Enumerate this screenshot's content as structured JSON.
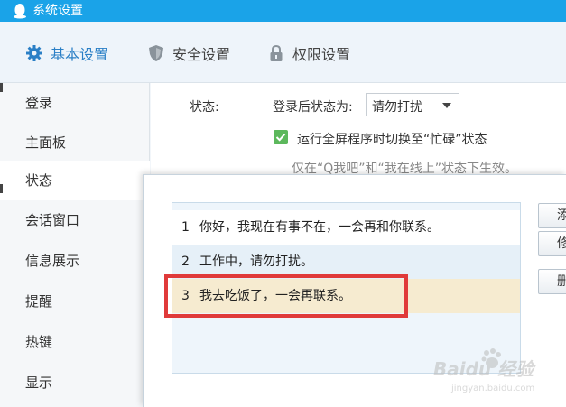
{
  "window": {
    "title": "系统设置"
  },
  "tabs": [
    {
      "label": "基本设置",
      "icon": "gear-icon",
      "active": true
    },
    {
      "label": "安全设置",
      "icon": "shield-icon",
      "active": false
    },
    {
      "label": "权限设置",
      "icon": "lock-icon",
      "active": false
    }
  ],
  "sidebar": {
    "items": [
      {
        "label": "登录"
      },
      {
        "label": "主面板"
      },
      {
        "label": "状态",
        "active": true
      },
      {
        "label": "会话窗口"
      },
      {
        "label": "信息展示"
      },
      {
        "label": "提醒"
      },
      {
        "label": "热键"
      },
      {
        "label": "显示"
      }
    ]
  },
  "main": {
    "status_label": "状态:",
    "after_login_label": "登录后状态为:",
    "after_login_value": "请勿打扰",
    "fullscreen_label": "运行全屏程序时切换至“忙碌”状态",
    "fullscreen_checked": true,
    "hint": "仅在“Q我吧”和“我在线上”状态下生效。"
  },
  "dialog": {
    "messages": [
      {
        "num": "1",
        "text": "你好，我现在有事不在，一会再和你联系。"
      },
      {
        "num": "2",
        "text": "工作中，请勿打扰。"
      },
      {
        "num": "3",
        "text": "我去吃饭了，一会再联系。",
        "selected": true
      }
    ],
    "buttons": [
      {
        "label": "添加"
      },
      {
        "label": "修改"
      },
      {
        "label": "删除"
      }
    ]
  },
  "watermark": {
    "brand": "Baidu 经验",
    "url": "jingyan.baidu.com"
  },
  "colors": {
    "titlebar": "#1aa3e8",
    "active_tab": "#2a7fc6",
    "highlight_border": "#e03a3a",
    "selected_row": "#f6ebd0",
    "checkbox": "#5cb85c"
  }
}
